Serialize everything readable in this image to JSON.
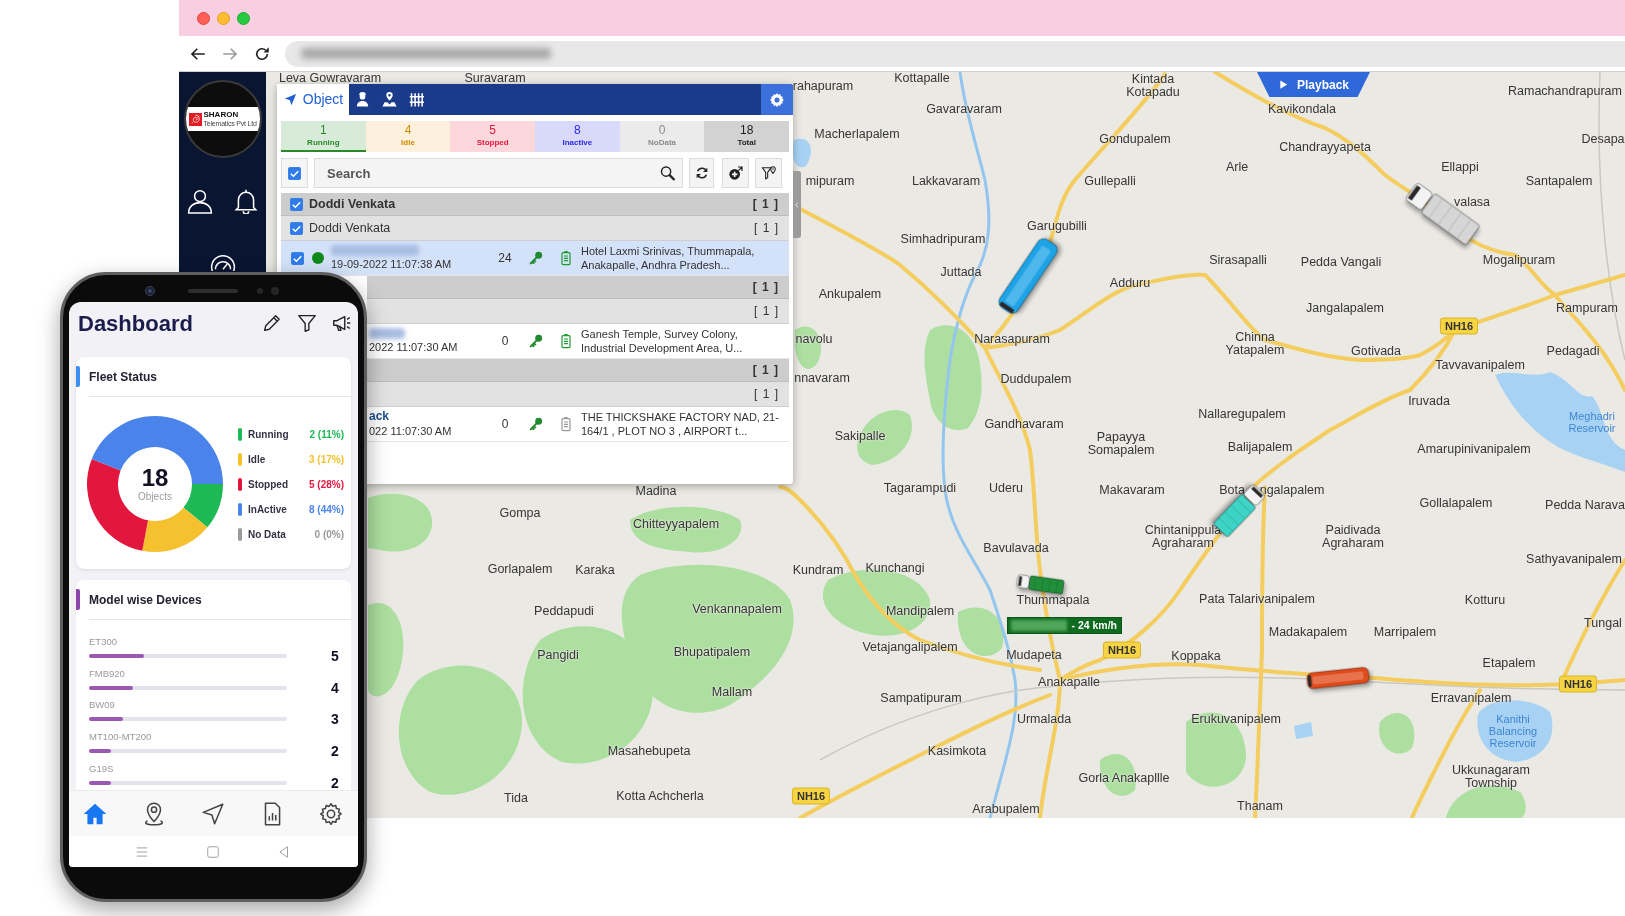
{
  "sidebar": {
    "logo": {
      "name": "SHARON",
      "tagline": "Telematics Pvt Ltd"
    }
  },
  "panel": {
    "tabs": [
      {
        "kind": "object",
        "label": "Object",
        "selected": true
      },
      {
        "kind": "driver",
        "selected": false
      },
      {
        "kind": "landmark",
        "selected": false
      },
      {
        "kind": "geofence",
        "selected": false
      }
    ],
    "status": [
      {
        "kind": "running",
        "count": "1",
        "label": "Running",
        "selected": true
      },
      {
        "kind": "idle",
        "count": "4",
        "label": "Idle",
        "selected": false
      },
      {
        "kind": "stopped",
        "count": "5",
        "label": "Stopped",
        "selected": false
      },
      {
        "kind": "inactive",
        "count": "8",
        "label": "Inactive",
        "selected": false
      },
      {
        "kind": "nodata",
        "count": "0",
        "label": "NoData",
        "selected": false
      },
      {
        "kind": "total",
        "count": "18",
        "label": "Total",
        "selected": false
      }
    ],
    "search": {
      "placeholder": "Search",
      "select_all": true
    },
    "tree": [
      {
        "kind": "group",
        "label": "Doddi Venkata",
        "count": "[ 1 ]",
        "checked": true,
        "children": [
          {
            "kind": "subgroup",
            "label": "Doddi Venkata",
            "count": "[ 1 ]",
            "checked": true,
            "children": [
              {
                "kind": "vehicle",
                "checked": true,
                "color": "#0f8a1a",
                "name_blurred": true,
                "time": "19-09-2022 11:07:38 AM",
                "speed": "24",
                "battery_ok": true,
                "address": "Hotel Laxmi Srinivas, Thummapala, Anakapalle, Andhra Pradesh...",
                "selected": true
              }
            ]
          }
        ]
      },
      {
        "kind": "group",
        "count": "[ 1 ]",
        "children": [
          {
            "kind": "subgroup",
            "count": "[ 1 ]",
            "children": [
              {
                "kind": "vehicle",
                "name_blurred": true,
                "time": "2022 11:07:30 AM",
                "speed": "0",
                "battery_ok": true,
                "address": "Ganesh Temple, Survey Colony, Industrial Development Area, U...",
                "selected": false
              }
            ]
          }
        ]
      },
      {
        "kind": "group",
        "count": "[ 1 ]",
        "children": [
          {
            "kind": "subgroup",
            "count": "[ 1 ]",
            "children": [
              {
                "kind": "vehicle",
                "name": "ack",
                "time": "022 11:07:30 AM",
                "speed": "0",
                "battery_ok": false,
                "address": "THE THICKSHAKE FACTORY NAD, 21-164/1 , PLOT NO 3 , AIRPORT t...",
                "selected": false
              }
            ]
          }
        ]
      }
    ]
  },
  "map": {
    "playback": "Playback",
    "labels": [
      {
        "text": "Leva Gowravaram",
        "kind": "place"
      },
      {
        "text": "Suravaram",
        "kind": "place"
      },
      {
        "text": "Kottapalle",
        "kind": "place"
      },
      {
        "text": "rahapuram",
        "kind": "place"
      },
      {
        "text": "Kintada Kotapadu",
        "kind": "place"
      },
      {
        "text": "Ramachandrapuram",
        "kind": "place"
      },
      {
        "text": "Gavaravaram",
        "kind": "place"
      },
      {
        "text": "Kavikondala",
        "kind": "place"
      },
      {
        "text": "Macherlapalem",
        "kind": "place"
      },
      {
        "text": "Gondupalem",
        "kind": "place"
      },
      {
        "text": "Desapa",
        "kind": "place"
      },
      {
        "text": "Chandrayyapeta",
        "kind": "place"
      },
      {
        "text": "Arle",
        "kind": "place"
      },
      {
        "text": "Ellappi",
        "kind": "place"
      },
      {
        "text": "mipuram",
        "kind": "place"
      },
      {
        "text": "Lakkavaram",
        "kind": "place"
      },
      {
        "text": "Gullepalli",
        "kind": "place"
      },
      {
        "text": "Santapalem",
        "kind": "place"
      },
      {
        "text": "valasa",
        "kind": "place"
      },
      {
        "text": "Garugubilli",
        "kind": "place"
      },
      {
        "text": "Simhadripuram",
        "kind": "place"
      },
      {
        "text": "Sirasapalli",
        "kind": "place"
      },
      {
        "text": "Pedda Vangali",
        "kind": "place"
      },
      {
        "text": "Mogalipuram",
        "kind": "place"
      },
      {
        "text": "Juttada",
        "kind": "place"
      },
      {
        "text": "Adduru",
        "kind": "place"
      },
      {
        "text": "Ankupalem",
        "kind": "place"
      },
      {
        "text": "Jangalapalem",
        "kind": "place"
      },
      {
        "text": "Rampuram",
        "kind": "place"
      },
      {
        "text": "NH16",
        "kind": "road"
      },
      {
        "text": "navolu",
        "kind": "place"
      },
      {
        "text": "Narasapuram",
        "kind": "place"
      },
      {
        "text": "Chinna Yatapalem",
        "kind": "place"
      },
      {
        "text": "Gotivada",
        "kind": "place"
      },
      {
        "text": "Pedagadi",
        "kind": "place"
      },
      {
        "text": "Tavvavanipalem",
        "kind": "place"
      },
      {
        "text": "nnavaram",
        "kind": "place"
      },
      {
        "text": "Duddupalem",
        "kind": "place"
      },
      {
        "text": "Iruvada",
        "kind": "place"
      },
      {
        "text": "Nallaregupalem",
        "kind": "place"
      },
      {
        "text": "Gandhavaram",
        "kind": "place"
      },
      {
        "text": "Meghadri Reservoir",
        "kind": "water"
      },
      {
        "text": "Sakipalle",
        "kind": "place"
      },
      {
        "text": "Papayya Somapalem",
        "kind": "place"
      },
      {
        "text": "Balijapalem",
        "kind": "place"
      },
      {
        "text": "Amarupinivanipalem",
        "kind": "place"
      },
      {
        "text": "Madina",
        "kind": "place"
      },
      {
        "text": "Tagarampudi",
        "kind": "place"
      },
      {
        "text": "Uderu",
        "kind": "place"
      },
      {
        "text": "Makavaram",
        "kind": "place"
      },
      {
        "text": "Bota",
        "kind": "place"
      },
      {
        "text": "ngalapalem",
        "kind": "place"
      },
      {
        "text": "Gollalapalem",
        "kind": "place"
      },
      {
        "text": "Pedda Narava",
        "kind": "place"
      },
      {
        "text": "Gompa",
        "kind": "place"
      },
      {
        "text": "Chitteyyapalem",
        "kind": "place"
      },
      {
        "text": "Bavulavada",
        "kind": "place"
      },
      {
        "text": "Chintanippula Agraharam",
        "kind": "place"
      },
      {
        "text": "Paidivada Agraharam",
        "kind": "place"
      },
      {
        "text": "Sathyavanipalem",
        "kind": "place"
      },
      {
        "text": "Gorlapalem",
        "kind": "place"
      },
      {
        "text": "Karaka",
        "kind": "place"
      },
      {
        "text": "Kundram",
        "kind": "place"
      },
      {
        "text": "Kunchangi",
        "kind": "place"
      },
      {
        "text": "Thummapala",
        "kind": "place"
      },
      {
        "text": "Pata Talarivanipalem",
        "kind": "place"
      },
      {
        "text": "Kotturu",
        "kind": "place"
      },
      {
        "text": "Peddapudi",
        "kind": "place"
      },
      {
        "text": "Venkannapalem",
        "kind": "place"
      },
      {
        "text": "Mandipalem",
        "kind": "place"
      },
      {
        "text": "Tungal",
        "kind": "place"
      },
      {
        "text": "Madakapalem",
        "kind": "place"
      },
      {
        "text": "Marripalem",
        "kind": "place"
      },
      {
        "text": "Pangidi",
        "kind": "place"
      },
      {
        "text": "Bhupatipalem",
        "kind": "place"
      },
      {
        "text": "Vetajangalipalem",
        "kind": "place"
      },
      {
        "text": "Mudapeta",
        "kind": "place"
      },
      {
        "text": "NH16",
        "kind": "road"
      },
      {
        "text": "Koppaka",
        "kind": "place"
      },
      {
        "text": "Etapalem",
        "kind": "place"
      },
      {
        "text": "Anakapalle",
        "kind": "place"
      },
      {
        "text": "NH16",
        "kind": "road"
      },
      {
        "text": "Mallam",
        "kind": "place"
      },
      {
        "text": "Sampatipuram",
        "kind": "place"
      },
      {
        "text": "Erravanipalem",
        "kind": "place"
      },
      {
        "text": "Urmalada",
        "kind": "place"
      },
      {
        "text": "Erukuvanipalem",
        "kind": "place"
      },
      {
        "text": "Kanithi Balancing Reservoir",
        "kind": "water"
      },
      {
        "text": "Masahebupeta",
        "kind": "place"
      },
      {
        "text": "Kasimkota",
        "kind": "place"
      },
      {
        "text": "Gorla Anakapllle",
        "kind": "place"
      },
      {
        "text": "Ukkunagaram Township",
        "kind": "place"
      },
      {
        "text": "Tida",
        "kind": "place"
      },
      {
        "text": "Kotta Achcherla",
        "kind": "place"
      },
      {
        "text": "NH16",
        "kind": "road"
      },
      {
        "text": "Arabupalem",
        "kind": "place"
      },
      {
        "text": "Thanam",
        "kind": "place"
      }
    ],
    "vehicles": [
      {
        "kind": "bus",
        "color": "#1ea3e6"
      },
      {
        "kind": "truck",
        "color": "#d6d6d6"
      },
      {
        "kind": "truck",
        "color": "#3dd3c5"
      },
      {
        "kind": "truck",
        "color": "#1f8f3a",
        "speed_tag": "- 24 km/h"
      },
      {
        "kind": "bus",
        "color": "#df4c1c"
      }
    ]
  },
  "phone": {
    "title": "Dashboard",
    "fleet_status": {
      "title": "Fleet Status",
      "center_value": "18",
      "center_label": "Objects",
      "legend": [
        {
          "reading": "2 (11%)",
          "color": "#1db954"
        },
        {
          "reading": "3 (17%)",
          "color": "#f5c12e"
        },
        {
          "reading": "5 (28%)",
          "color": "#e3173e"
        },
        {
          "reading": "8 (44%)",
          "color": "#4a84ea"
        },
        {
          "reading": "0 (0%)",
          "color": "#9a9a9a"
        }
      ],
      "chart_data": {
        "type": "donut",
        "categories": [
          "Running",
          "Idle",
          "Stopped",
          "InActive",
          "No Data"
        ],
        "values": [
          11,
          17,
          28,
          44,
          0
        ]
      }
    },
    "models": {
      "title": "Model wise Devices",
      "rows": [
        {
          "label": "ET300",
          "count": "5",
          "level": 0.28
        },
        {
          "label": "FMB920",
          "count": "4",
          "level": 0.22
        },
        {
          "label": "BW09",
          "count": "3",
          "level": 0.17
        },
        {
          "label": "MT100-MT200",
          "count": "2",
          "level": 0.11
        },
        {
          "label": "G19S",
          "count": "2",
          "level": 0.11
        }
      ]
    },
    "nav": [
      {
        "kind": "home",
        "selected": true
      },
      {
        "kind": "places",
        "selected": false
      },
      {
        "kind": "tracking",
        "selected": false
      },
      {
        "kind": "reports",
        "selected": false
      },
      {
        "kind": "settings",
        "selected": false
      }
    ]
  }
}
